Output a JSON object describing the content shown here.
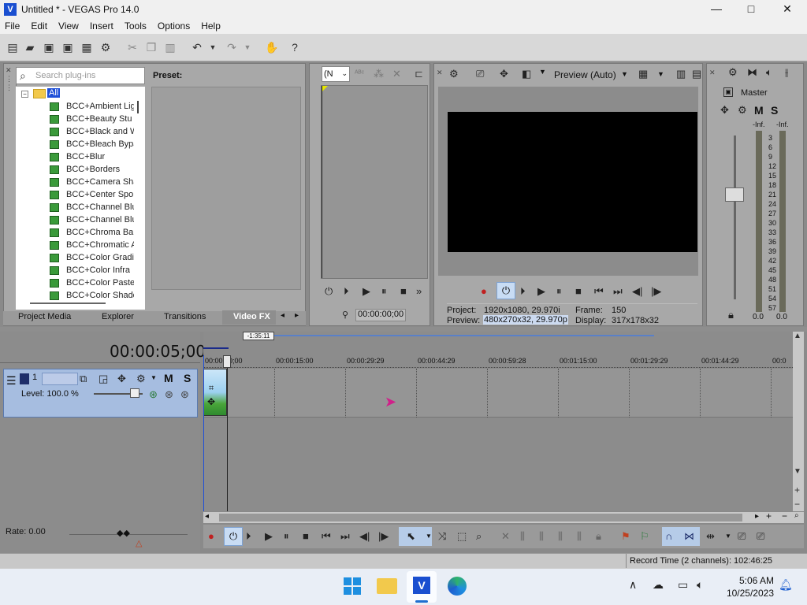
{
  "window": {
    "title": "Untitled * - VEGAS Pro 14.0",
    "min": "—",
    "max": "□",
    "close": "✕"
  },
  "menu": [
    "File",
    "Edit",
    "View",
    "Insert",
    "Tools",
    "Options",
    "Help"
  ],
  "plugins": {
    "search_placeholder": "Search plug-ins",
    "preset_label": "Preset:",
    "root": "All",
    "items": [
      "BCC+Ambient Lig",
      "BCC+Beauty Stu",
      "BCC+Black and W",
      "BCC+Bleach Bypa",
      "BCC+Blur",
      "BCC+Borders",
      "BCC+Camera Sha",
      "BCC+Center Spo",
      "BCC+Channel Blu",
      "BCC+Channel Blu",
      "BCC+Chroma Bar",
      "BCC+Chromatic A",
      "BCC+Color Gradi",
      "BCC+Color Infra",
      "BCC+Color Paste",
      "BCC+Color Shade"
    ]
  },
  "tabs": [
    "Project Media",
    "Explorer",
    "Transitions",
    "Video FX"
  ],
  "trimmer": {
    "dropdown": "(N",
    "timecode": "00:00:00;00"
  },
  "preview": {
    "mode": "Preview (Auto)",
    "project_label": "Project:",
    "project_value": "1920x1080, 29.970i",
    "frame_label": "Frame:",
    "frame_value": "150",
    "preview_label": "Preview:",
    "preview_value": "480x270x32, 29.970p",
    "display_label": "Display:",
    "display_value": "317x178x32"
  },
  "master": {
    "title": "Master",
    "m": "M",
    "s": "S",
    "left_inf": "-Inf.",
    "right_inf": "-Inf.",
    "scale": [
      "3",
      "6",
      "9",
      "12",
      "15",
      "18",
      "21",
      "24",
      "27",
      "30",
      "33",
      "36",
      "39",
      "42",
      "45",
      "48",
      "51",
      "54",
      "57"
    ],
    "left_val": "0.0",
    "right_val": "0.0"
  },
  "timeline": {
    "timecode": "00:00:05;00",
    "region": "-1:35:11",
    "ruler": [
      "00:00:00;00",
      "00:00:15:00",
      "00:00:29:29",
      "00:00:44:29",
      "00:00:59:28",
      "00:01:15:00",
      "00:01:29:29",
      "00:01:44:29",
      "00:0"
    ],
    "track_number": "1",
    "level": "Level: 100.0 %",
    "m": "M",
    "s": "S",
    "rate": "Rate: 0.00",
    "record_time": "Record Time (2 channels): 102:46:25"
  },
  "taskbar": {
    "time": "5:06 AM",
    "date": "10/25/2023"
  },
  "colors": {
    "panel": "#a8a8a8",
    "toolbar": "#d8d8d8",
    "accent": "#1e4fd8",
    "track": "#a6bde0"
  }
}
